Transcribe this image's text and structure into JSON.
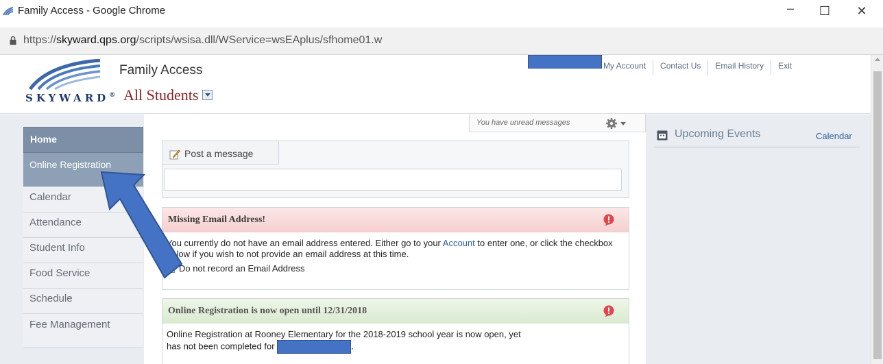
{
  "window": {
    "title": "Family Access - Google Chrome",
    "minimize": "–",
    "maximize": "☐",
    "close": "✕"
  },
  "address": {
    "url_prefix": "https://",
    "url_host": "skyward.qps.org",
    "url_path": "/scripts/wsisa.dll/WService=wsEAplus/sfhome01.w"
  },
  "header": {
    "logo_text": "SKYWARD",
    "logo_mark": "®",
    "app_name": "Family Access",
    "student_selector": "All Students",
    "topnav": [
      "My Account",
      "Contact Us",
      "Email History",
      "Exit"
    ]
  },
  "sidebar": {
    "items": [
      "Home",
      "Online Registration",
      "Calendar",
      "Attendance",
      "Student Info",
      "Food Service",
      "Schedule",
      "Fee Management"
    ]
  },
  "main": {
    "unread": "You have unread messages",
    "post_tab": "Post a message",
    "email_alert": {
      "title": "Missing Email Address!",
      "body_before": "You currently do not have an email address entered. Either go to your ",
      "body_link": "Account",
      "body_after": " to enter one, or click the checkbox below if you wish to not provide an email address at this time.",
      "checkbox_label": "Do not record an Email Address"
    },
    "reg_alert": {
      "title": "Online Registration is now open until 12/31/2018",
      "body_line1": "Online Registration at Rooney Elementary for the 2018-2019 school year is now open, yet",
      "body_line2": "has not been completed for",
      "body_end": "."
    }
  },
  "right": {
    "events_title": "Upcoming Events",
    "calendar_link": "Calendar"
  },
  "colors": {
    "redaction": "#4472c4",
    "annotation_arrow": "#3f6fd0",
    "sidebar_active": "#7c8fa6"
  },
  "icons": [
    "skyward-icon",
    "lock-icon",
    "dropdown-arrow-icon",
    "gear-icon",
    "pencil-icon",
    "exclamation-icon",
    "calendar-icon"
  ]
}
